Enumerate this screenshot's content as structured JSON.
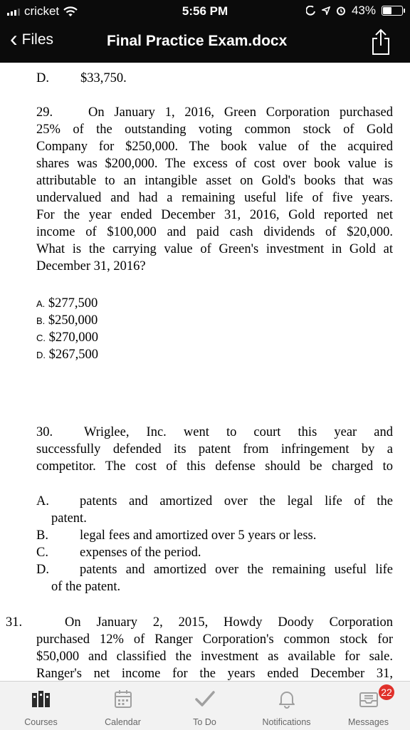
{
  "status": {
    "carrier": "cricket",
    "time": "5:56 PM",
    "battery": "43%"
  },
  "nav": {
    "back_label": "Files",
    "title": "Final Practice Exam.docx"
  },
  "doc": {
    "prev_d_letter": "D.",
    "prev_d_value": "$33,750.",
    "q29": {
      "number": "29.",
      "lines": [
        "On January 1, 2016, Green Corporation purchased",
        "25% of the outstanding voting common stock of Gold",
        "Company for $250,000. The book value of the acquired",
        "shares was $200,000. The excess of cost over book value is",
        "attributable to an intangible asset on Gold's books that was",
        "undervalued and had a remaining useful life of five years.",
        "For the year ended December 31, 2016, Gold reported net",
        "income of $100,000 and paid cash dividends of $20,000.",
        "What is the carrying value of Green's investment in Gold at",
        "December 31, 2016?"
      ],
      "options": [
        {
          "letter": "A.",
          "text": "$277,500"
        },
        {
          "letter": "B.",
          "text": "$250,000"
        },
        {
          "letter": "C.",
          "text": "$270,000"
        },
        {
          "letter": "D.",
          "text": "$267,500"
        }
      ]
    },
    "q30": {
      "number": "30.",
      "lines": [
        "Wriglee, Inc. went to court this year and",
        "successfully defended its patent from infringement by a",
        "competitor. The cost of this defense should be charged to"
      ],
      "options": [
        {
          "letter": "A.",
          "text": "patents and amortized over the legal life of the",
          "cont": "patent."
        },
        {
          "letter": "B.",
          "text": "legal fees and amortized over 5 years or less."
        },
        {
          "letter": "C.",
          "text": "expenses of the period."
        },
        {
          "letter": "D.",
          "text": "patents and amortized over the remaining useful life",
          "cont": "of the patent."
        }
      ]
    },
    "q31": {
      "number": "31.",
      "lines": [
        "On January 2, 2015, Howdy Doody Corporation",
        "purchased 12% of Ranger Corporation's common stock for",
        "$50,000 and classified the investment as available for sale.",
        "Ranger's net income for the years ended December 31,"
      ]
    }
  },
  "tabs": [
    {
      "label": "Courses",
      "icon": "courses-icon"
    },
    {
      "label": "Calendar",
      "icon": "calendar-icon"
    },
    {
      "label": "To Do",
      "icon": "checkmark-icon"
    },
    {
      "label": "Notifications",
      "icon": "bell-icon"
    },
    {
      "label": "Messages",
      "icon": "inbox-icon",
      "badge": "22"
    }
  ],
  "colors": {
    "header_bg": "#0b0b0b",
    "badge": "#e0312b",
    "tab_bg": "#f2f2f2",
    "tab_icon": "#9a9a9a"
  }
}
